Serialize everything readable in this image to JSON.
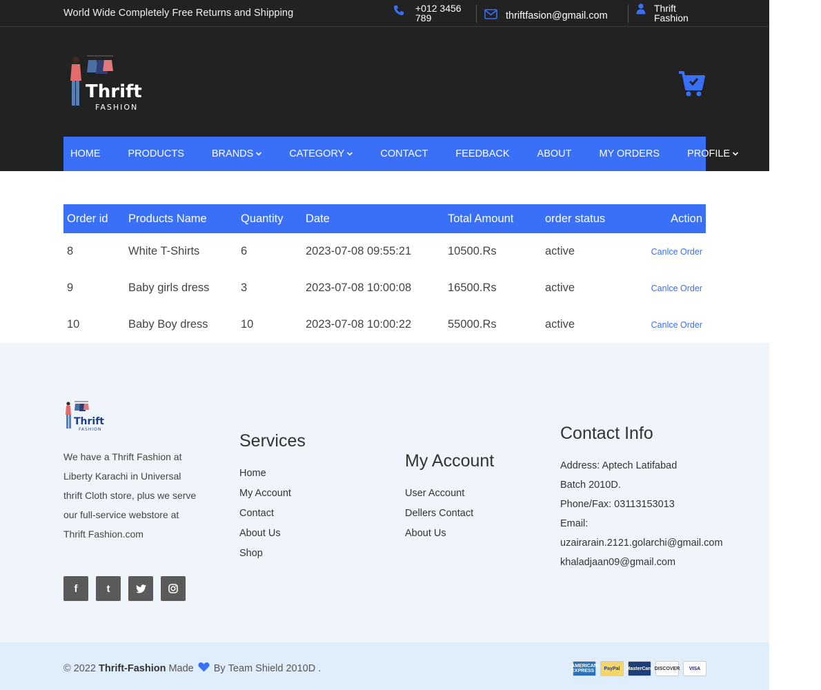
{
  "topbar": {
    "promo": "World Wide Completely Free Returns and Shipping",
    "phone": "+012 3456 789",
    "email": "thriftfasion@gmail.com",
    "user": "Thrift Fashion"
  },
  "header": {
    "logo_text_main": "Thrift",
    "logo_text_sub": "FASHION",
    "nav": [
      {
        "label": "HOME",
        "dropdown": false
      },
      {
        "label": "PRODUCTS",
        "dropdown": false
      },
      {
        "label": "BRANDS",
        "dropdown": true
      },
      {
        "label": "CATEGORY",
        "dropdown": true
      },
      {
        "label": "CONTACT",
        "dropdown": false
      },
      {
        "label": "FEEDBACK",
        "dropdown": false
      },
      {
        "label": "ABOUT",
        "dropdown": false
      },
      {
        "label": "MY ORDERS",
        "dropdown": false
      },
      {
        "label": "PROFILE",
        "dropdown": true
      }
    ]
  },
  "orders": {
    "headers": [
      "Order id",
      "Products Name",
      "Quantity",
      "Date",
      "Total Amount",
      "order status",
      "Action"
    ],
    "rows": [
      {
        "id": "8",
        "product": "White T-Shirts",
        "quantity": "6",
        "date": "2023-07-08 09:55:21",
        "total": "10500.Rs",
        "status": "active",
        "action": "Canlce Order"
      },
      {
        "id": "9",
        "product": "Baby girls dress",
        "quantity": "3",
        "date": "2023-07-08 10:00:08",
        "total": "16500.Rs",
        "status": "active",
        "action": "Canlce Order"
      },
      {
        "id": "10",
        "product": "Baby Boy dress",
        "quantity": "10",
        "date": "2023-07-08 10:00:22",
        "total": "55000.Rs",
        "status": "active",
        "action": "Canlce Order"
      }
    ]
  },
  "footer": {
    "logo_text_main": "Thrift",
    "logo_text_sub": "FASHION",
    "about": "We have a Thrift Fashion at Liberty Karachi in Universal thrift Cloth store, plus we serve our full-service webstore at Thrift Fashion.com",
    "services": {
      "title": "Services",
      "links": [
        "Home",
        "My Account",
        "Contact",
        "About Us",
        "Shop"
      ]
    },
    "account": {
      "title": "My Account",
      "links": [
        "User Account",
        "Dellers Contact",
        "About Us"
      ]
    },
    "contact": {
      "title": "Contact Info",
      "lines": [
        "Address: Aptech Latifabad",
        "Batch 2010D.",
        "Phone/Fax: 03113153013",
        "Email:",
        "uzairarain.2121.golarchi@gmail.com",
        "khaladjaan09@gmail.com"
      ]
    },
    "social": [
      "f",
      "t",
      "twitter",
      "instagram"
    ]
  },
  "bottom": {
    "copy_prefix": "© 2022",
    "brand": "Thrift-Fashion",
    "made": "Made",
    "by": "By",
    "team": "Team Shield 2010D .",
    "payments": [
      {
        "label": "AMERICAN EXPRESS",
        "bg": "#2b6fb6",
        "fg": "#ffffff"
      },
      {
        "label": "PayPal",
        "bg": "#f6d569",
        "fg": "#1b3c87"
      },
      {
        "label": "MasterCard",
        "bg": "#1c3f7a",
        "fg": "#ffffff"
      },
      {
        "label": "DISCOVER",
        "bg": "#ffffff",
        "fg": "#333333"
      },
      {
        "label": "VISA",
        "bg": "#ffffff",
        "fg": "#1a1f71"
      }
    ]
  },
  "colors": {
    "accent": "#3a6ff7",
    "dark": "#222222",
    "footer_bg": "#eff5fb",
    "bottom_bg": "#e0eefb"
  }
}
